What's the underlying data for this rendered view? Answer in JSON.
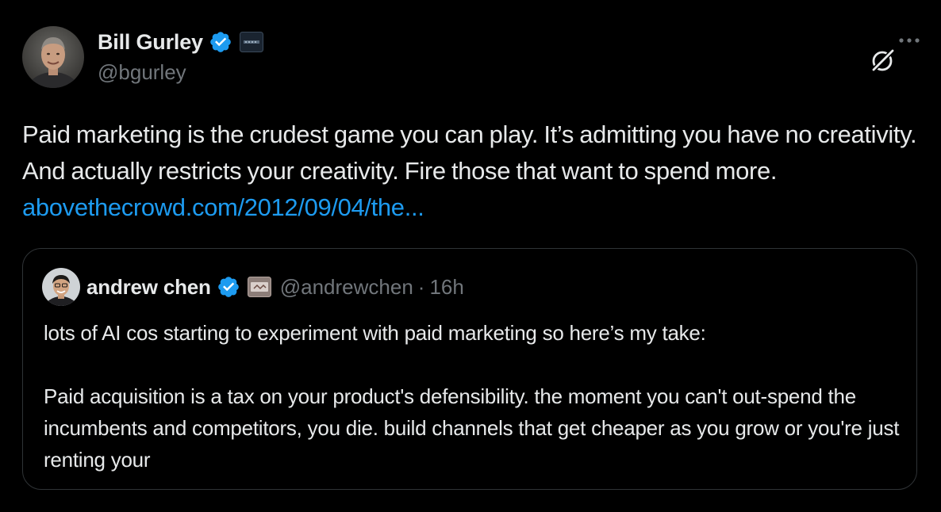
{
  "author": {
    "display_name": "Bill Gurley",
    "handle": "@bgurley"
  },
  "tweet": {
    "text": "Paid marketing is the crudest game you can play. It’s admitting you have no creativity. And actually restricts your creativity. Fire those that want to spend more. ",
    "link_text": "abovethecrowd.com/2012/09/04/the..."
  },
  "quoted": {
    "display_name": "andrew chen",
    "handle": "@andrewchen",
    "separator": "·",
    "time": "16h",
    "paragraph1": "lots of AI cos starting to experiment with paid marketing so here’s my take:",
    "paragraph2": "Paid acquisition is a tax on your product's defensibility. the moment you can't out-spend the incumbents and competitors, you die. build channels that get cheaper as you grow or you're just renting your"
  },
  "icons": {
    "verified": "verified-check-icon",
    "affiliate": "affiliate-badge-icon",
    "grok": "grok-icon",
    "more": "more-icon"
  },
  "colors": {
    "background": "#000000",
    "text": "#e7e9ea",
    "secondary_text": "#71767b",
    "link": "#1d9bf0",
    "verified_badge": "#1d9bf0",
    "border": "#2f3336"
  }
}
